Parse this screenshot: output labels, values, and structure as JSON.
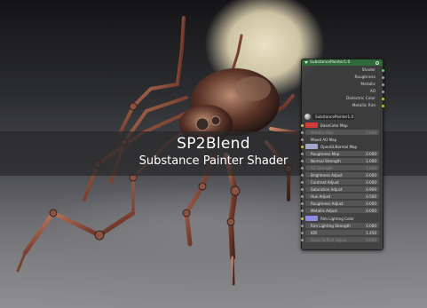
{
  "banner": {
    "title": "SP2Blend",
    "subtitle": "Substance Painter Shader"
  },
  "node": {
    "title": "SubstancePainter1.0",
    "outputs": [
      "Shader",
      "Roughness",
      "Metallic",
      "AO",
      "Dielectric Color",
      "Metallic Rim"
    ],
    "selector_value": "SubstancePainter1.0",
    "basecolor_map_label": "BaseColor Map",
    "basecolor_swatch": "#d23b3b",
    "rows_a": [
      {
        "label": "Metallic Map",
        "value": "0.000",
        "dim": true
      },
      {
        "label": "Mixed AO Map",
        "value": "",
        "dim": false
      }
    ],
    "normal_map_label": "OpenGLNormal Map",
    "normal_swatch": "#a3a6c8",
    "rows_b": [
      {
        "label": "Roughness Map",
        "value": "0.000",
        "dim": false
      },
      {
        "label": "Normal Strength",
        "value": "1.000",
        "dim": false
      },
      {
        "label": "AO Strength",
        "value": "1.000",
        "dim": true
      },
      {
        "label": "Brightness Adjust",
        "value": "0.000",
        "dim": false
      },
      {
        "label": "Contrast Adjust",
        "value": "0.000",
        "dim": false
      },
      {
        "label": "Saturation Adjust",
        "value": "0.900",
        "dim": false
      },
      {
        "label": "Hue Adjust",
        "value": "0.500",
        "dim": false
      },
      {
        "label": "Roughness Adjust",
        "value": "0.000",
        "dim": false
      },
      {
        "label": "Metallic Adjust",
        "value": "0.000",
        "dim": false
      }
    ],
    "rim_color_label": "Rim Lighting Color",
    "rim_swatch": "#8c8ce0",
    "rows_c": [
      {
        "label": "Rim Lighting Strength",
        "value": "0.000",
        "dim": false
      },
      {
        "label": "IOR",
        "value": "1.450",
        "dim": false
      },
      {
        "label": "Glass Reflect Adjust",
        "value": "0.000",
        "dim": true
      }
    ]
  }
}
